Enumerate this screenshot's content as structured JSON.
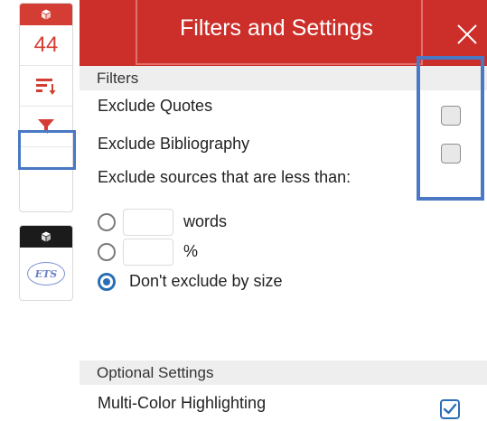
{
  "sidebar": {
    "score": "44",
    "icons": [
      "sort-icon",
      "filter-icon"
    ],
    "ets_badge": "ETS"
  },
  "panel": {
    "title": "Filters and Settings",
    "close_icon": "close-icon"
  },
  "filters": {
    "section_label": "Filters",
    "exclude_quotes": {
      "label": "Exclude Quotes",
      "checked": false
    },
    "exclude_bibliography": {
      "label": "Exclude Bibliography",
      "checked": false
    },
    "exclude_small_label": "Exclude sources that are less than:",
    "size_options": [
      {
        "unit": "words",
        "value": "",
        "selected": false
      },
      {
        "unit": "%",
        "value": "",
        "selected": false
      },
      {
        "label": "Don't exclude by size",
        "selected": true
      }
    ]
  },
  "optional_settings": {
    "section_label": "Optional Settings",
    "multi_color": {
      "label": "Multi-Color Highlighting",
      "checked": true
    }
  },
  "colors": {
    "header_red": "#cc2f2a",
    "highlight_blue": "#4a78c5",
    "check_blue": "#2b6fb8"
  }
}
